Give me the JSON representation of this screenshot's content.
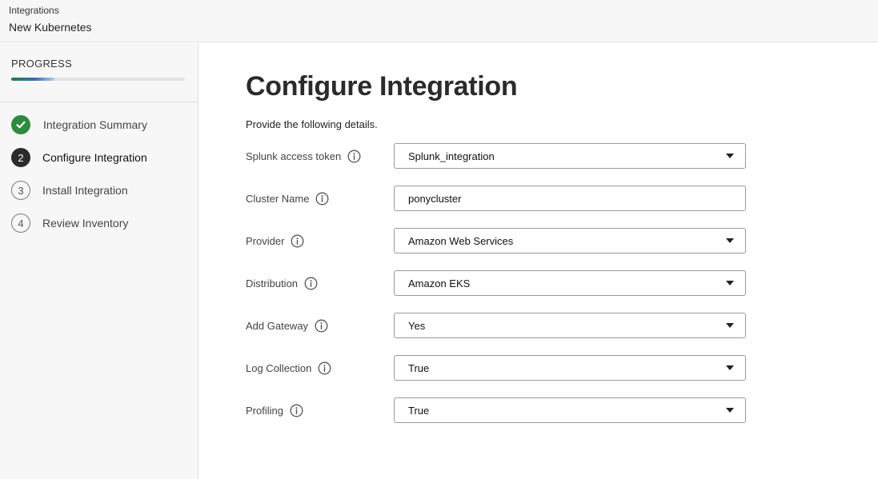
{
  "header": {
    "breadcrumb": "Integrations",
    "title": "New Kubernetes"
  },
  "sidebar": {
    "progress_label": "PROGRESS",
    "progress_fraction": 0.25,
    "steps": [
      {
        "number": "",
        "label": "Integration Summary",
        "state": "done"
      },
      {
        "number": "2",
        "label": "Configure Integration",
        "state": "active"
      },
      {
        "number": "3",
        "label": "Install Integration",
        "state": "todo"
      },
      {
        "number": "4",
        "label": "Review Inventory",
        "state": "todo"
      }
    ]
  },
  "main": {
    "title": "Configure Integration",
    "intro": "Provide the following details.",
    "fields": [
      {
        "label": "Splunk access token",
        "value": "Splunk_integration",
        "type": "select"
      },
      {
        "label": "Cluster Name",
        "value": "ponycluster",
        "type": "text"
      },
      {
        "label": "Provider",
        "value": "Amazon Web Services",
        "type": "select"
      },
      {
        "label": "Distribution",
        "value": "Amazon EKS",
        "type": "select"
      },
      {
        "label": "Add Gateway",
        "value": "Yes",
        "type": "select"
      },
      {
        "label": "Log Collection",
        "value": "True",
        "type": "select"
      },
      {
        "label": "Profiling",
        "value": "True",
        "type": "select"
      }
    ]
  },
  "colors": {
    "done": "#2e8b3e",
    "active": "#2b2b2b"
  },
  "icons": {
    "done_step": "checkmark-icon",
    "field_help": "info-icon",
    "select": "caret-down-icon"
  }
}
